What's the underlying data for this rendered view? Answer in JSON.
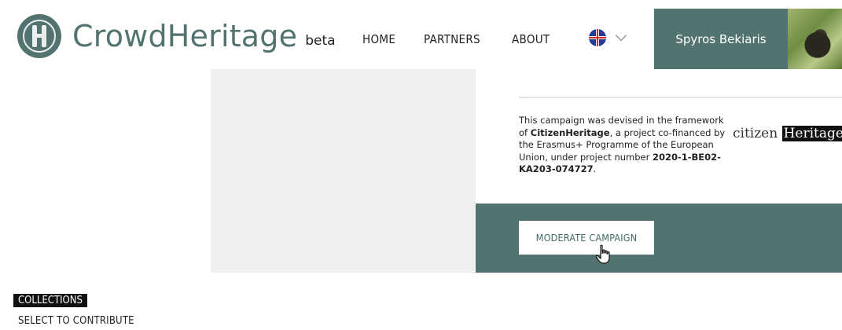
{
  "header": {
    "brand": "CrowdHeritage",
    "beta": "beta",
    "nav": [
      {
        "label": "HOME"
      },
      {
        "label": "PARTNERS"
      },
      {
        "label": "ABOUT"
      }
    ],
    "language_icon": "uk-flag-icon",
    "user_name": "Spyros Bekiaris"
  },
  "info": {
    "p1": "This campaign was devised in the framework of ",
    "project_name": "CitizenHeritage",
    "p2": ", a project co-financed by the Erasmus+ Programme of the European Union, under project number ",
    "project_number": "2020-1-BE02-KA203-074727",
    "p3": ".",
    "partner_logo_a": "citizen",
    "partner_logo_b": "Heritage"
  },
  "actions": {
    "moderate_label": "MODERATE CAMPAIGN"
  },
  "collections": {
    "title": "COLLECTIONS",
    "subtitle": "SELECT TO CONTRIBUTE"
  },
  "colors": {
    "brand_green": "#52736f"
  }
}
